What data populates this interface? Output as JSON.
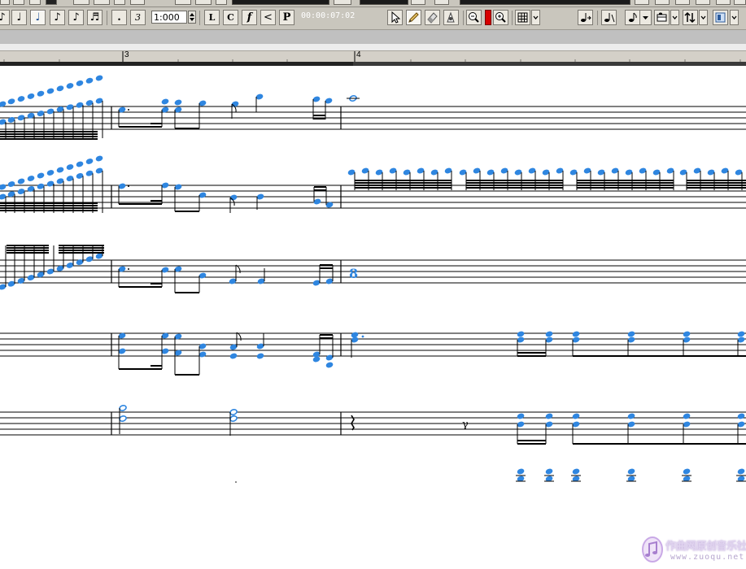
{
  "toolbar": {
    "quantize_value": "1:000",
    "time_readout": "00:00:07:02",
    "buttons": [
      {
        "label": "♪",
        "name": "note-whole-button"
      },
      {
        "label": "♩",
        "name": "note-half-button"
      },
      {
        "label": "♩",
        "name": "note-quarter-button"
      },
      {
        "label": "♪",
        "name": "note-eighth-button"
      },
      {
        "label": "♪",
        "name": "note-sixteenth-button"
      },
      {
        "label": "♬",
        "name": "note-thirtysecond-button"
      }
    ],
    "dot_label": ".",
    "triplet_label": "3",
    "L_label": "L",
    "C_label": "C",
    "f_label": "f",
    "lt_label": "<",
    "ped_label": "P"
  },
  "ruler": {
    "bar_labels": [
      "3",
      "4"
    ]
  },
  "colors": {
    "note_blue": "#2f86e0",
    "staff_line": "#000000",
    "toolbar_bg": "#c9c6bd",
    "ruler_bg": "#d4d0c8"
  },
  "watermark": {
    "text": "作曲网原创音乐社区",
    "url": "www.zuoqu.net"
  }
}
